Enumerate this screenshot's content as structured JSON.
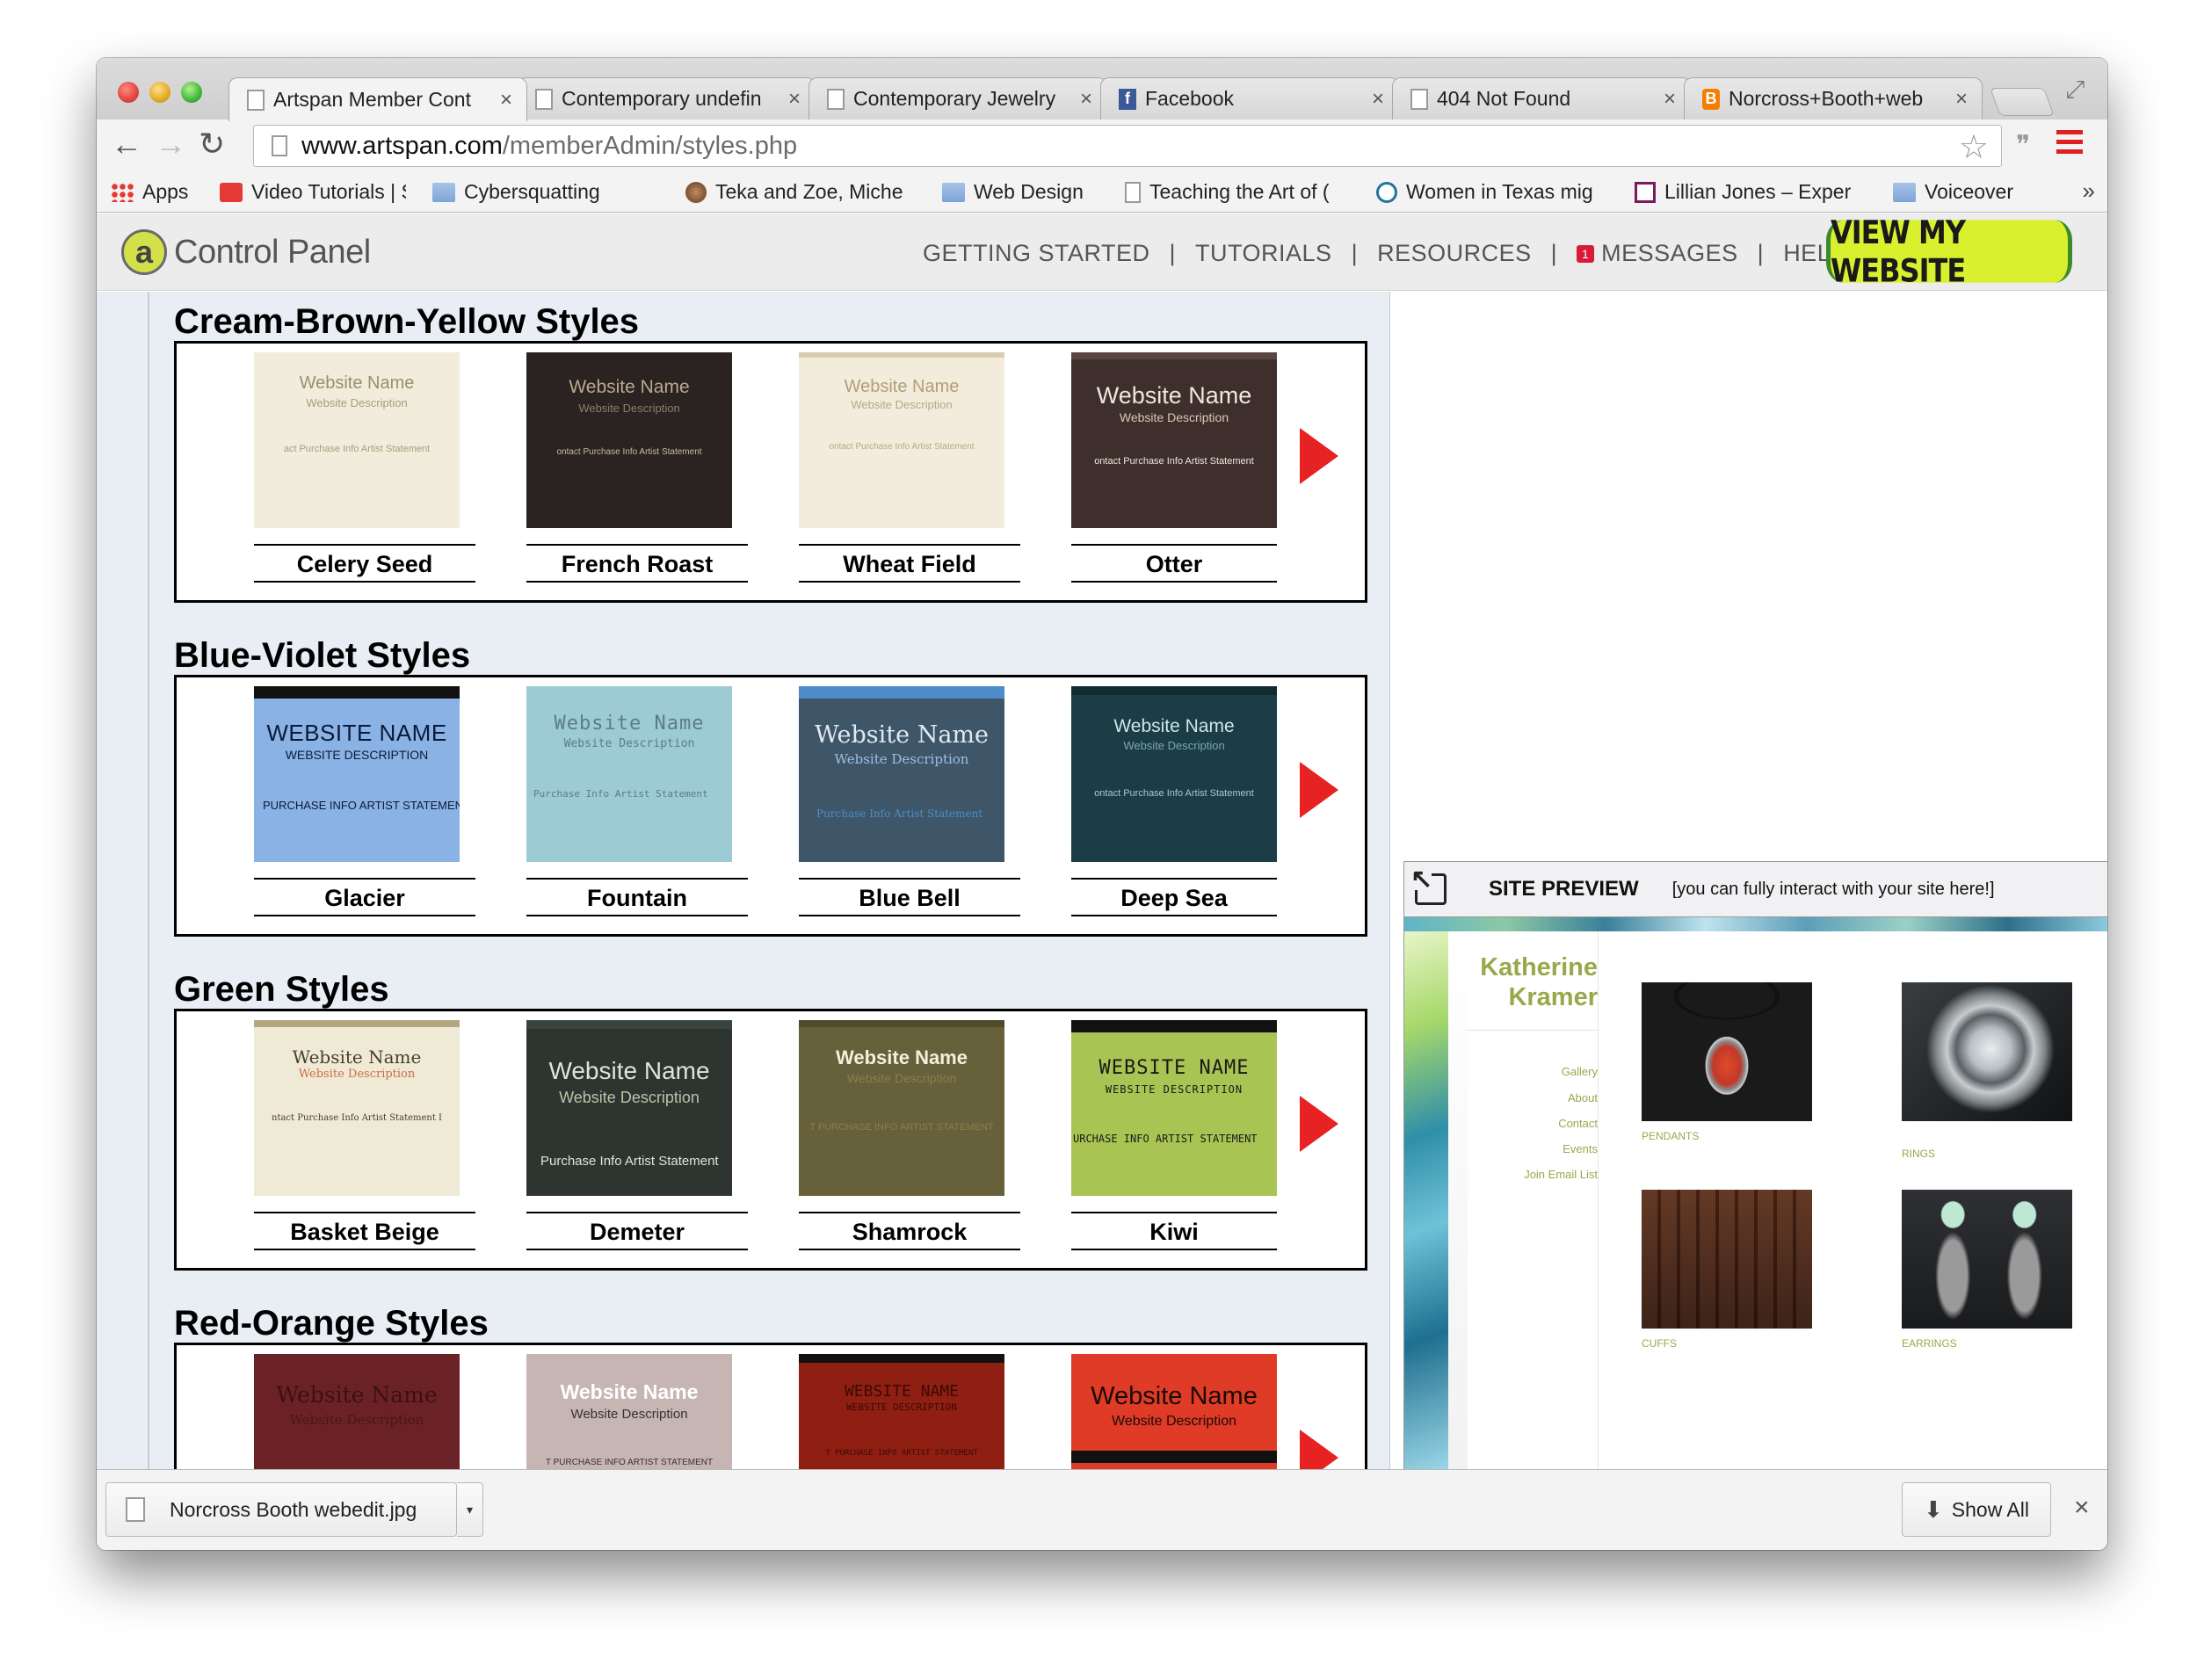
{
  "browser": {
    "tabs": [
      {
        "title": "Artspan Member Cont",
        "icon": "page-icon",
        "active": true
      },
      {
        "title": "Contemporary undefin",
        "icon": "page-icon"
      },
      {
        "title": "Contemporary Jewelry",
        "icon": "page-icon"
      },
      {
        "title": "Facebook",
        "icon": "facebook-icon"
      },
      {
        "title": "404 Not Found",
        "icon": "page-icon"
      },
      {
        "title": "Norcross+Booth+web",
        "icon": "blogger-icon"
      }
    ],
    "url_domain": "www.artspan.com",
    "url_path": "/memberAdmin/styles.php",
    "bookmarks": [
      {
        "label": "Apps",
        "icon": "apps-icon"
      },
      {
        "label": "Video Tutorials | Ske",
        "icon": "video-icon"
      },
      {
        "label": "Cybersquatting",
        "icon": "folder-icon"
      },
      {
        "label": "Teka and Zoe, Miche",
        "icon": "avatar-icon"
      },
      {
        "label": "Web Design",
        "icon": "folder-icon"
      },
      {
        "label": "Teaching the Art of (",
        "icon": "page-icon"
      },
      {
        "label": "Women in Texas mig",
        "icon": "wordpress-icon"
      },
      {
        "label": "Lillian Jones – Exper",
        "icon": "site-icon"
      },
      {
        "label": "Voiceover",
        "icon": "folder-icon"
      }
    ],
    "bookmarks_more": "»"
  },
  "header": {
    "logo_letter": "a",
    "logo_text": "Control Panel",
    "nav": [
      {
        "label": "GETTING STARTED"
      },
      {
        "label": "TUTORIALS"
      },
      {
        "label": "RESOURCES"
      },
      {
        "label": "MESSAGES",
        "badge": "1"
      },
      {
        "label": "HELPDESK"
      }
    ],
    "nav_separator": "|",
    "view_site_label": "VIEW MY WEBSITE"
  },
  "tile_text": {
    "name_title": "Website Name",
    "desc_title": "Website Description",
    "name_upper": "WEBSITE NAME",
    "desc_upper": "WEBSITE DESCRIPTION",
    "links_a": "act   Purchase Info   Artist Statement",
    "links_b": "ontact   Purchase Info   Artist Statement",
    "links_c": "Contact   Purchase Info   Artist Statement",
    "links_d": "PURCHASE INFO    ARTIST STATEMENT",
    "links_e": "Purchase Info   Artist Statement",
    "links_f": "ntact   Purchase Info   Artist Statement   I",
    "links_g": "T   PURCHASE INFO   ARTIST STATEMENT",
    "links_h": "URCHASE  INFO   ARTIST  STATEMENT",
    "links_i": "T   PURCHASE INFO   ARTIST STATEMENT"
  },
  "sections": [
    {
      "title": "Cream-Brown-Yellow Styles",
      "styles": [
        "Celery Seed",
        "French Roast",
        "Wheat Field",
        "Otter"
      ]
    },
    {
      "title": "Blue-Violet Styles",
      "styles": [
        "Glacier",
        "Fountain",
        "Blue Bell",
        "Deep Sea"
      ]
    },
    {
      "title": "Green Styles",
      "styles": [
        "Basket Beige",
        "Demeter",
        "Shamrock",
        "Kiwi"
      ]
    },
    {
      "title": "Red-Orange Styles",
      "styles": []
    }
  ],
  "preview": {
    "label": "SITE PREVIEW",
    "hint": "[you can fully interact with your site here!]",
    "site_name_first": "Katherine",
    "site_name_last": "Kramer",
    "menu": [
      "Gallery",
      "About",
      "Contact",
      "Events",
      "Join Email List"
    ],
    "galleries": [
      "PENDANTS",
      "RINGS",
      "CUFFS",
      "EARRINGS"
    ]
  },
  "downloads": {
    "file_name": "Norcross Booth webedit.jpg",
    "show_all_label": "Show All",
    "close": "×"
  }
}
